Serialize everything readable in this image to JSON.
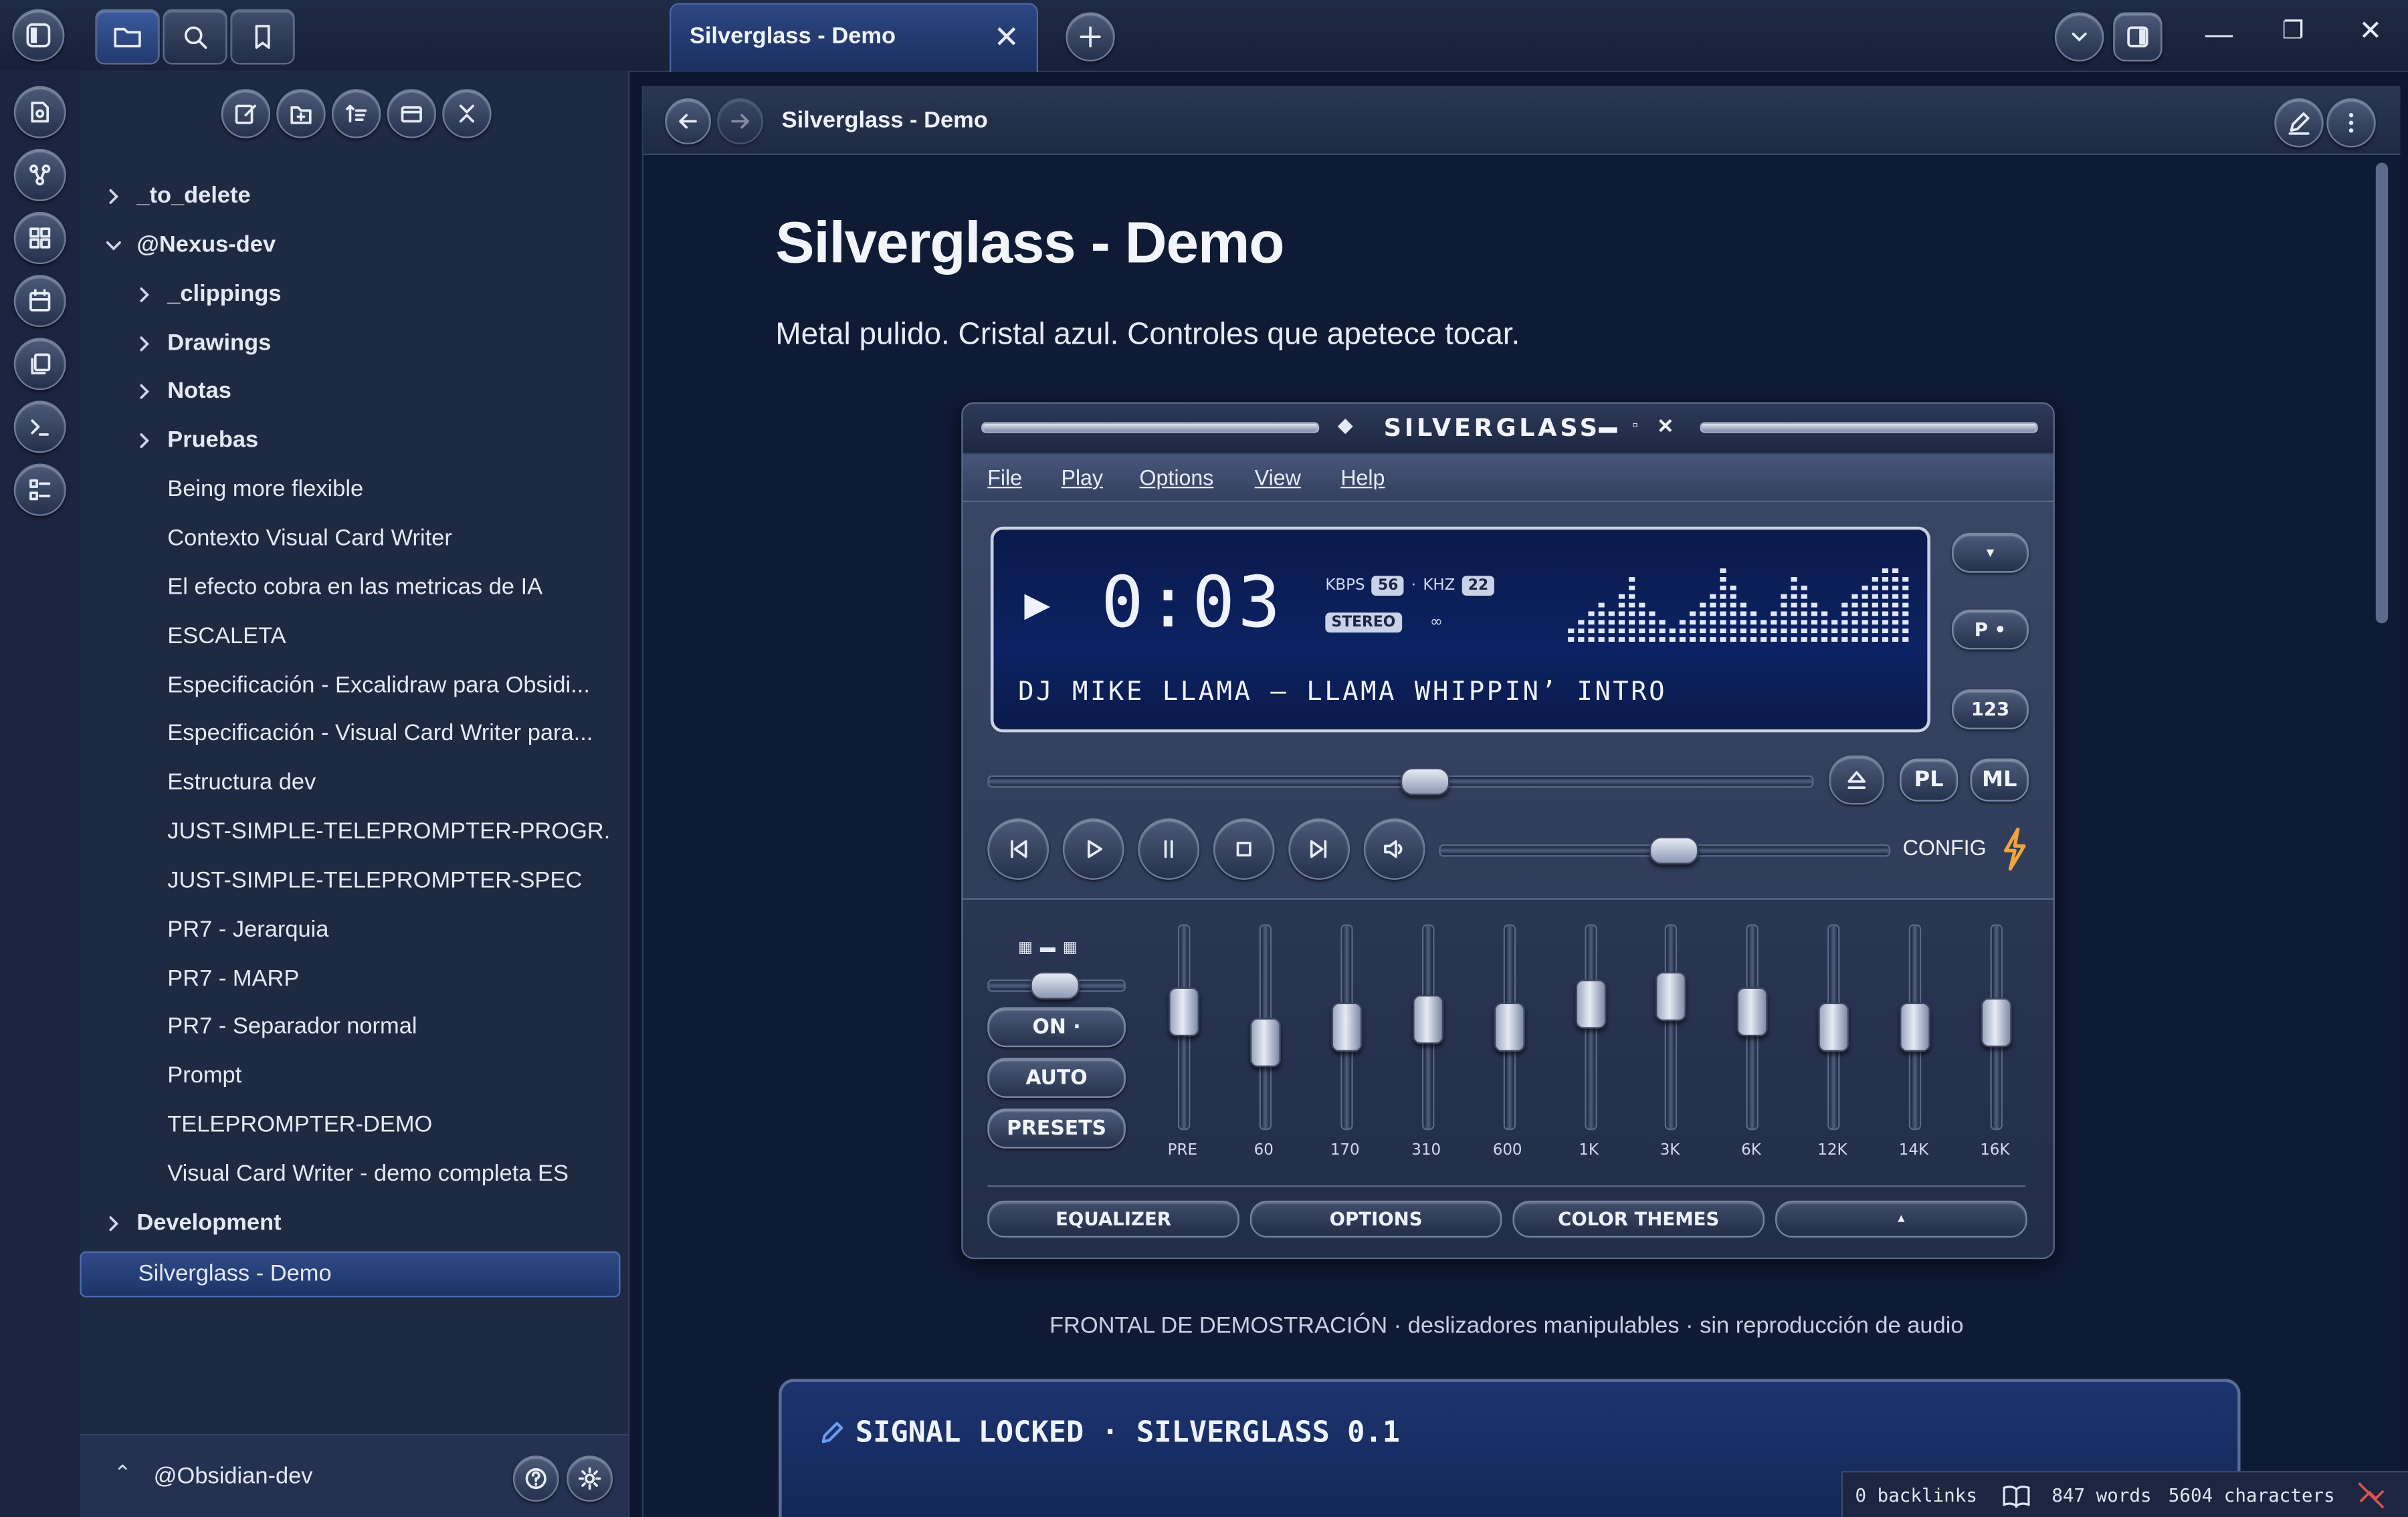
{
  "app": {
    "tab_title": "Silverglass - Demo",
    "breadcrumb": "Silverglass - Demo"
  },
  "sidebar": {
    "vault_name": "@Obsidian-dev",
    "items": [
      {
        "label": "_to_delete",
        "type": "folder",
        "expanded": false,
        "depth": 0
      },
      {
        "label": "@Nexus-dev",
        "type": "folder",
        "expanded": true,
        "depth": 0
      },
      {
        "label": "_clippings",
        "type": "folder",
        "expanded": false,
        "depth": 1
      },
      {
        "label": "Drawings",
        "type": "folder",
        "expanded": false,
        "depth": 1
      },
      {
        "label": "Notas",
        "type": "folder",
        "expanded": false,
        "depth": 1
      },
      {
        "label": "Pruebas",
        "type": "folder",
        "expanded": false,
        "depth": 1
      },
      {
        "label": "Being more flexible",
        "type": "file",
        "depth": 1
      },
      {
        "label": "Contexto Visual Card Writer",
        "type": "file",
        "depth": 1
      },
      {
        "label": "El efecto cobra en las metricas de IA",
        "type": "file",
        "depth": 1
      },
      {
        "label": "ESCALETA",
        "type": "file",
        "depth": 1
      },
      {
        "label": "Especificación - Excalidraw para Obsidi...",
        "type": "file",
        "depth": 1
      },
      {
        "label": "Especificación - Visual Card Writer para...",
        "type": "file",
        "depth": 1
      },
      {
        "label": "Estructura dev",
        "type": "file",
        "depth": 1
      },
      {
        "label": "JUST-SIMPLE-TELEPROMPTER-PROGR...",
        "type": "file",
        "depth": 1
      },
      {
        "label": "JUST-SIMPLE-TELEPROMPTER-SPEC",
        "type": "file",
        "depth": 1
      },
      {
        "label": "PR7 - Jerarquia",
        "type": "file",
        "depth": 1
      },
      {
        "label": "PR7 - MARP",
        "type": "file",
        "depth": 1
      },
      {
        "label": "PR7 - Separador normal",
        "type": "file",
        "depth": 1
      },
      {
        "label": "Prompt",
        "type": "file",
        "depth": 1
      },
      {
        "label": "TELEPROMPTER-DEMO",
        "type": "file",
        "depth": 1
      },
      {
        "label": "Visual Card Writer - demo completa ES",
        "type": "file",
        "depth": 1
      },
      {
        "label": "Development",
        "type": "folder",
        "expanded": false,
        "depth": 0
      },
      {
        "label": "Silverglass - Demo",
        "type": "file",
        "depth": 0,
        "selected": true
      }
    ]
  },
  "note": {
    "title": "Silverglass - Demo",
    "subtitle": "Metal pulido. Cristal azul. Controles que apetece tocar.",
    "caption": "FRONTAL DE DEMOSTRACIÓN · deslizadores manipulables · sin reproducción de audio",
    "signal_text": "SIGNAL LOCKED · SILVERGLASS 0.1"
  },
  "player": {
    "title": "SILVERGLASS",
    "menu": [
      "File",
      "Play",
      "Options",
      "View",
      "Help"
    ],
    "time": "0:03",
    "kbps_label": "KBPS",
    "kbps": "56",
    "khz_label": "KHZ",
    "khz": "22",
    "stereo": "STEREO",
    "infinity": "∞",
    "track": "DJ MIKE LLAMA — LLAMA WHIPPIN’ INTRO",
    "side_buttons": [
      "▾",
      "P •",
      "123"
    ],
    "pl": "PL",
    "ml": "ML",
    "config": "CONFIG",
    "seek_position": 0.53,
    "volume": 0.52,
    "eq_on": "ON ·",
    "eq_auto": "AUTO",
    "eq_presets": "PRESETS",
    "eq_bands": [
      "PRE",
      "60",
      "170",
      "310",
      "600",
      "1K",
      "3K",
      "6K",
      "12K",
      "14K",
      "16K"
    ],
    "eq_levels": [
      0.6,
      0.4,
      0.5,
      0.55,
      0.5,
      0.65,
      0.7,
      0.6,
      0.5,
      0.5,
      0.53
    ],
    "bottom_tabs": [
      "EQUALIZER",
      "OPTIONS",
      "COLOR THEMES",
      "▴"
    ],
    "spectrum": [
      2,
      3,
      4,
      5,
      4,
      6,
      8,
      5,
      4,
      3,
      2,
      3,
      4,
      5,
      6,
      9,
      7,
      5,
      4,
      3,
      4,
      6,
      8,
      7,
      5,
      4,
      3,
      5,
      6,
      7,
      8,
      9,
      9,
      8
    ]
  },
  "status": {
    "backlinks": "0 backlinks",
    "words": "847 words",
    "chars": "5604 characters"
  },
  "colors": {
    "accent": "#2f4a86",
    "background": "#0f1a35",
    "lcd": "#0a1a4a",
    "config_bolt": "#f3a43a"
  }
}
